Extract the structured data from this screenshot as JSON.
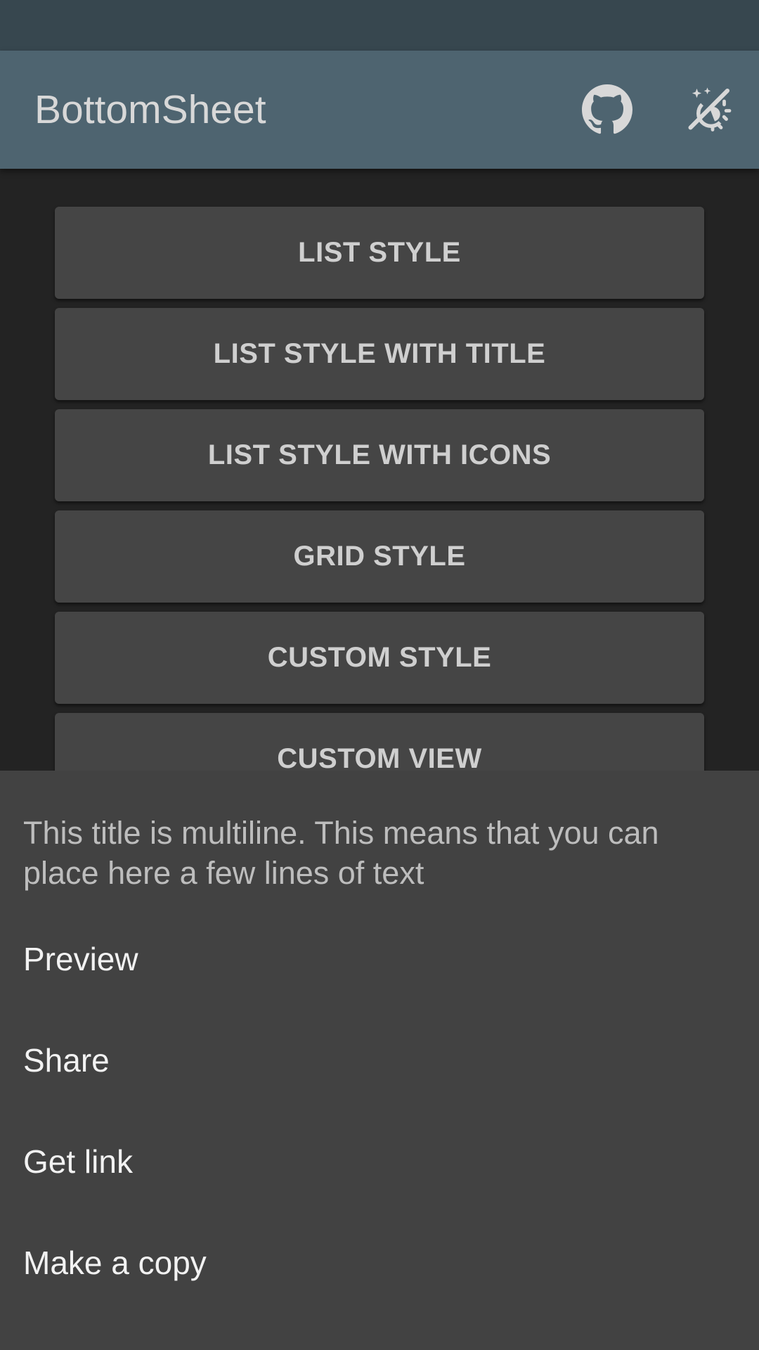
{
  "app_bar": {
    "title": "BottomSheet",
    "actions": [
      {
        "icon": "github-icon"
      },
      {
        "icon": "theme-toggle-icon"
      }
    ]
  },
  "buttons": [
    {
      "label": "LIST STYLE"
    },
    {
      "label": "LIST STYLE WITH TITLE"
    },
    {
      "label": "LIST STYLE WITH ICONS"
    },
    {
      "label": "GRID STYLE"
    },
    {
      "label": "CUSTOM STYLE"
    },
    {
      "label": "CUSTOM VIEW"
    }
  ],
  "bottom_sheet": {
    "title": "This title is multiline. This means that you can place here a few lines of text",
    "items": [
      {
        "label": "Preview"
      },
      {
        "label": "Share"
      },
      {
        "label": "Get link"
      },
      {
        "label": "Make a copy"
      }
    ]
  },
  "colors": {
    "status_bar": "#37474f",
    "app_bar": "#4e6470",
    "background": "#232323",
    "button": "#454545",
    "sheet": "#424242"
  }
}
